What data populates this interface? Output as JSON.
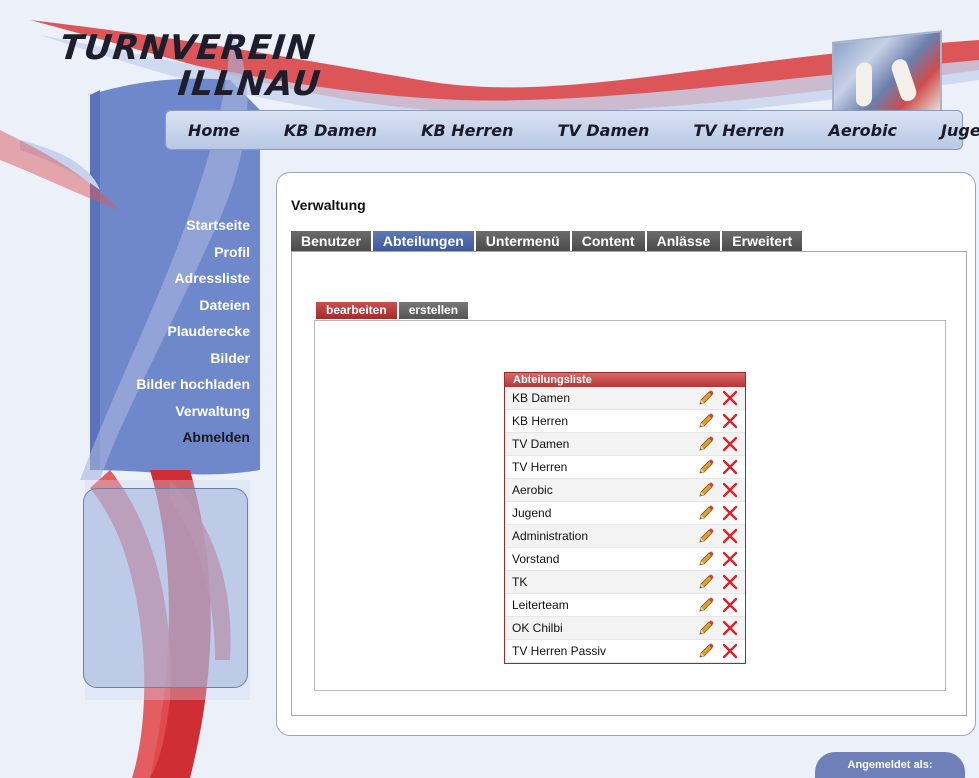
{
  "logo": {
    "line1": "TURNVEREIN",
    "line2": "ILLNAU"
  },
  "nav": [
    "Home",
    "KB Damen",
    "KB Herren",
    "TV Damen",
    "TV Herren",
    "Aerobic",
    "Jugend"
  ],
  "sidebar": {
    "items": [
      {
        "label": "Startseite"
      },
      {
        "label": "Profil"
      },
      {
        "label": "Adressliste"
      },
      {
        "label": "Dateien"
      },
      {
        "label": "Plauderecke"
      },
      {
        "label": "Bilder"
      },
      {
        "label": "Bilder hochladen"
      },
      {
        "label": "Verwaltung"
      },
      {
        "label": "Abmelden"
      }
    ],
    "active_index": 8
  },
  "page": {
    "title": "Verwaltung"
  },
  "tabs": [
    "Benutzer",
    "Abteilungen",
    "Untermenü",
    "Content",
    "Anlässe",
    "Erweitert"
  ],
  "active_tab": 1,
  "subtabs": [
    "bearbeiten",
    "erstellen"
  ],
  "active_subtab": 0,
  "list": {
    "title": "Abteilungsliste",
    "rows": [
      "KB Damen",
      "KB Herren",
      "TV Damen",
      "TV Herren",
      "Aerobic",
      "Jugend",
      "Administration",
      "Vorstand",
      "TK",
      "Leiterteam",
      "OK Chilbi",
      "TV Herren Passiv"
    ],
    "edit_icon": "pencil-icon",
    "delete_icon": "red-x-icon"
  },
  "footer": {
    "login_label": "Angemeldet als:"
  },
  "colors": {
    "accent_blue": "#3f5a9a",
    "accent_red": "#b73535",
    "tab_grey": "#4a4a4a"
  }
}
